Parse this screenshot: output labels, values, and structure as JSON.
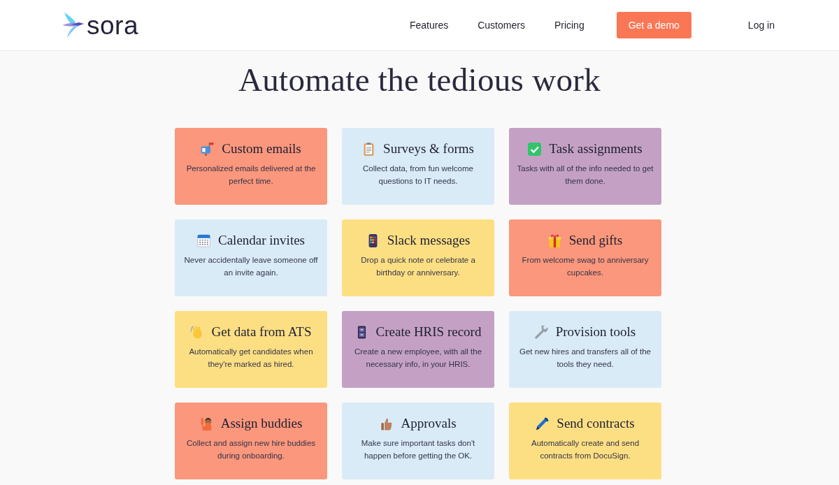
{
  "header": {
    "logo": {
      "text": "sora"
    },
    "nav": [
      {
        "label": "Features"
      },
      {
        "label": "Customers"
      },
      {
        "label": "Pricing"
      }
    ],
    "cta": "Get a demo",
    "login": "Log in"
  },
  "heading": "Automate the tedious work",
  "cards": [
    {
      "title": "Custom emails",
      "description": "Personalized emails delivered at the perfect time.",
      "color": "#fa977c"
    },
    {
      "title": "Surveys & forms",
      "description": "Collect data, from fun welcome questions to IT needs.",
      "color": "#d9ebf7"
    },
    {
      "title": "Task assignments",
      "description": "Tasks with all of the info needed to get them done.",
      "color": "#c4a1c4"
    },
    {
      "title": "Calendar invites",
      "description": "Never accidentally leave someone off an invite again.",
      "color": "#d9ebf7"
    },
    {
      "title": "Slack messages",
      "description": "Drop a quick note or celebrate a birthday or anniversary.",
      "color": "#fddf83"
    },
    {
      "title": "Send gifts",
      "description": "From welcome swag to anniversary cupcakes.",
      "color": "#fa977c"
    },
    {
      "title": "Get data from ATS",
      "description": "Automatically get candidates when they're marked as hired.",
      "color": "#fddf83"
    },
    {
      "title": "Create HRIS record",
      "description": "Create a new employee, with all the necessary info, in your HRIS.",
      "color": "#c4a1c4"
    },
    {
      "title": "Provision tools",
      "description": "Get new hires and transfers all of the tools they need.",
      "color": "#d9ebf7"
    },
    {
      "title": "Assign buddies",
      "description": "Collect and assign new hire buddies during onboarding.",
      "color": "#fa977c"
    },
    {
      "title": "Approvals",
      "description": "Make sure important tasks don't happen before getting the OK.",
      "color": "#d9ebf7"
    },
    {
      "title": "Send contracts",
      "description": "Automatically create and send contracts from DocuSign.",
      "color": "#fddf83"
    }
  ]
}
